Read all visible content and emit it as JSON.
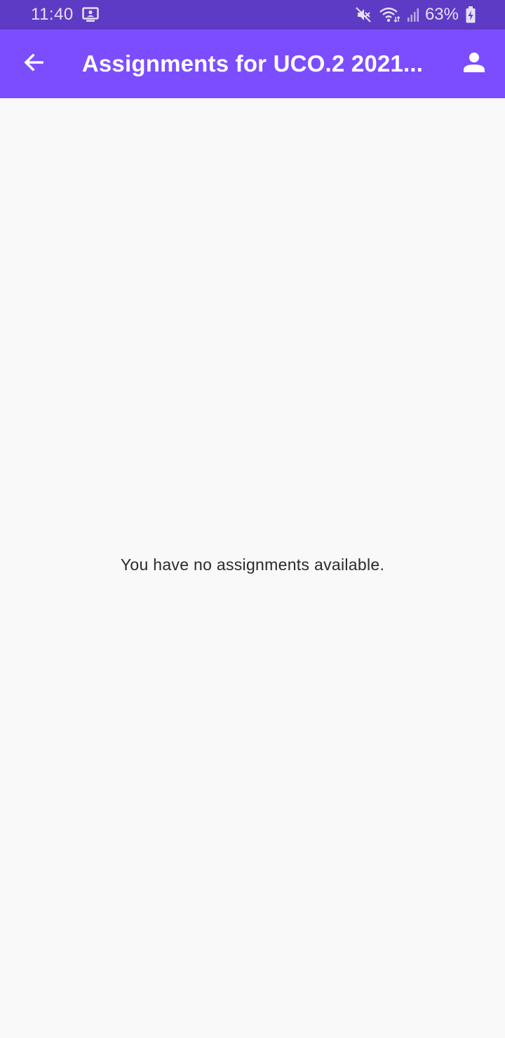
{
  "status_bar": {
    "time": "11:40",
    "battery": "63%",
    "icons": [
      "screen-cast-icon",
      "mute-icon",
      "wifi-icon",
      "signal-icon",
      "battery-charging-icon"
    ]
  },
  "app_bar": {
    "title": "Assignments for UCO.2 2021...",
    "back_icon": "arrow-back-icon",
    "profile_icon": "person-icon"
  },
  "content": {
    "empty_message": "You have no assignments available."
  },
  "colors": {
    "status_bar": "#5e3bc4",
    "app_bar": "#7c4dff",
    "background": "#f9f9f9"
  }
}
